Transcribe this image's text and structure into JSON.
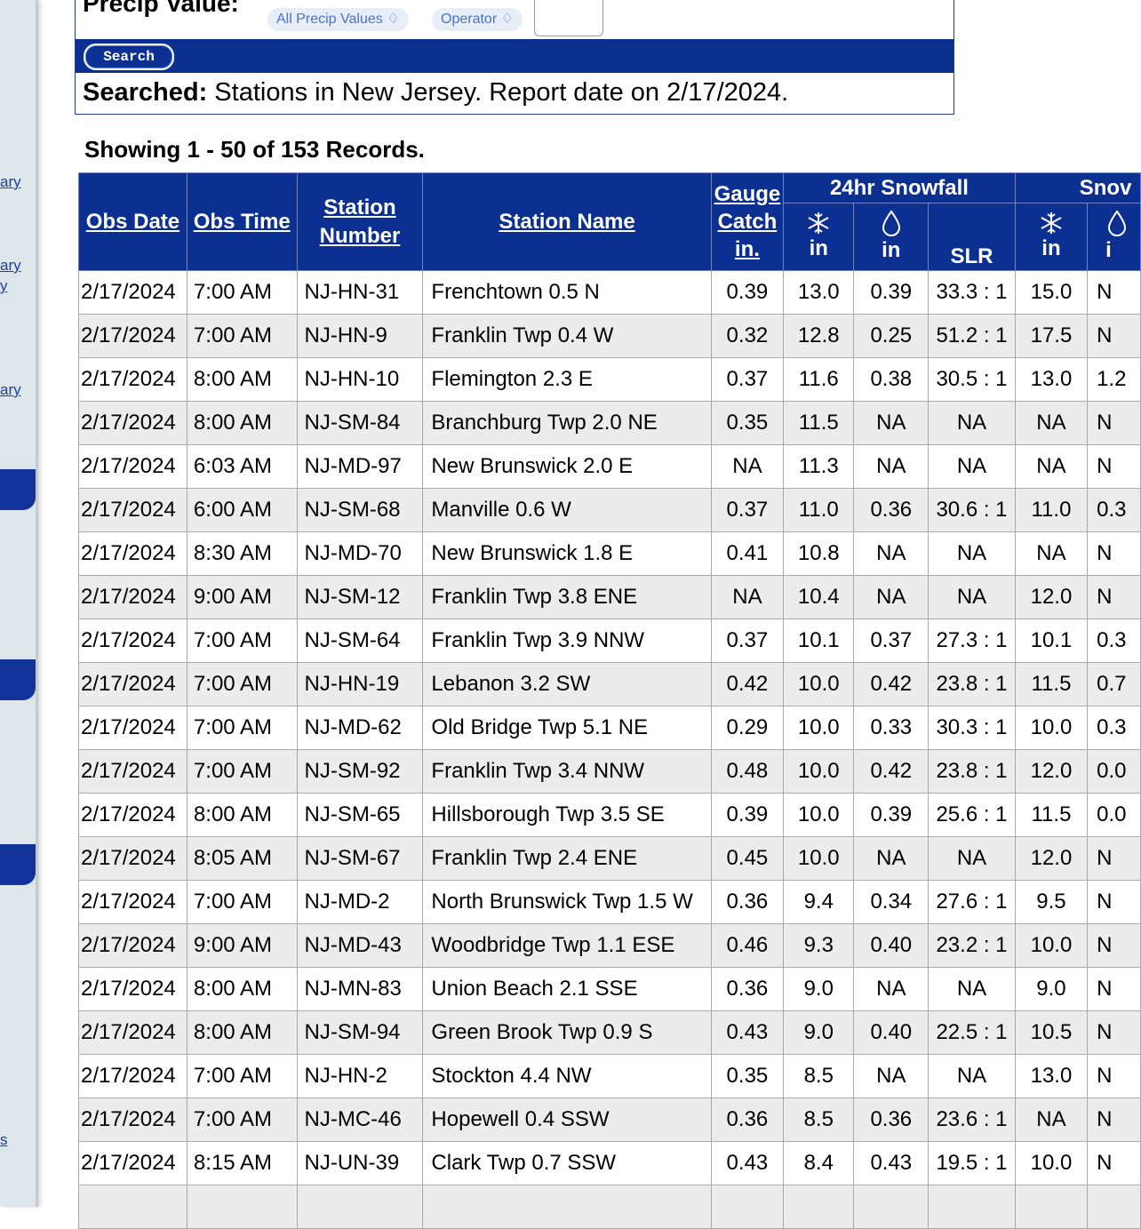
{
  "sidebar": {
    "links": [
      "ary",
      "ary",
      "y",
      "ary",
      "s"
    ]
  },
  "search_form": {
    "precip_label": "Precip Value:",
    "precip_select": "All Precip Values ♢",
    "operator_select": "Operator ♢",
    "precip_input_value": "",
    "search_button": "Search",
    "searched_label": "Searched:",
    "searched_text": " Stations in New Jersey. Report date on 2/17/2024."
  },
  "results": {
    "showing": "Showing 1 - 50 of 153 Records."
  },
  "table": {
    "headers": {
      "obs_date": "Obs Date",
      "obs_time": "Obs Time",
      "station_number": "Station Number",
      "station_name": "Station Name",
      "gauge_catch_1": "Gauge",
      "gauge_catch_2": "Catch",
      "gauge_catch_3": "in.",
      "snowfall_group": "24hr Snowfall",
      "snow_group": "Snov",
      "unit_in": "in",
      "slr": "SLR",
      "unit_in_clipped": "i"
    },
    "rows": [
      [
        "2/17/2024",
        "7:00 AM",
        "NJ-HN-31",
        "Frenchtown 0.5 N",
        "0.39",
        "13.0",
        "0.39",
        "33.3 : 1",
        "15.0",
        "N"
      ],
      [
        "2/17/2024",
        "7:00 AM",
        "NJ-HN-9",
        "Franklin Twp 0.4 W",
        "0.32",
        "12.8",
        "0.25",
        "51.2 : 1",
        "17.5",
        "N"
      ],
      [
        "2/17/2024",
        "8:00 AM",
        "NJ-HN-10",
        "Flemington 2.3 E",
        "0.37",
        "11.6",
        "0.38",
        "30.5 : 1",
        "13.0",
        "1.2"
      ],
      [
        "2/17/2024",
        "8:00 AM",
        "NJ-SM-84",
        "Branchburg Twp 2.0 NE",
        "0.35",
        "11.5",
        "NA",
        "NA",
        "NA",
        "N"
      ],
      [
        "2/17/2024",
        "6:03 AM",
        "NJ-MD-97",
        "New Brunswick 2.0 E",
        "NA",
        "11.3",
        "NA",
        "NA",
        "NA",
        "N"
      ],
      [
        "2/17/2024",
        "6:00 AM",
        "NJ-SM-68",
        "Manville 0.6 W",
        "0.37",
        "11.0",
        "0.36",
        "30.6 : 1",
        "11.0",
        "0.3"
      ],
      [
        "2/17/2024",
        "8:30 AM",
        "NJ-MD-70",
        "New Brunswick 1.8 E",
        "0.41",
        "10.8",
        "NA",
        "NA",
        "NA",
        "N"
      ],
      [
        "2/17/2024",
        "9:00 AM",
        "NJ-SM-12",
        "Franklin Twp 3.8 ENE",
        "NA",
        "10.4",
        "NA",
        "NA",
        "12.0",
        "N"
      ],
      [
        "2/17/2024",
        "7:00 AM",
        "NJ-SM-64",
        "Franklin Twp 3.9 NNW",
        "0.37",
        "10.1",
        "0.37",
        "27.3 : 1",
        "10.1",
        "0.3"
      ],
      [
        "2/17/2024",
        "7:00 AM",
        "NJ-HN-19",
        "Lebanon 3.2 SW",
        "0.42",
        "10.0",
        "0.42",
        "23.8 : 1",
        "11.5",
        "0.7"
      ],
      [
        "2/17/2024",
        "7:00 AM",
        "NJ-MD-62",
        "Old Bridge Twp 5.1 NE",
        "0.29",
        "10.0",
        "0.33",
        "30.3 : 1",
        "10.0",
        "0.3"
      ],
      [
        "2/17/2024",
        "7:00 AM",
        "NJ-SM-92",
        "Franklin Twp 3.4 NNW",
        "0.48",
        "10.0",
        "0.42",
        "23.8 : 1",
        "12.0",
        "0.0"
      ],
      [
        "2/17/2024",
        "8:00 AM",
        "NJ-SM-65",
        "Hillsborough Twp 3.5 SE",
        "0.39",
        "10.0",
        "0.39",
        "25.6 : 1",
        "11.5",
        "0.0"
      ],
      [
        "2/17/2024",
        "8:05 AM",
        "NJ-SM-67",
        "Franklin Twp 2.4 ENE",
        "0.45",
        "10.0",
        "NA",
        "NA",
        "12.0",
        "N"
      ],
      [
        "2/17/2024",
        "7:00 AM",
        "NJ-MD-2",
        "North Brunswick Twp 1.5 W",
        "0.36",
        "9.4",
        "0.34",
        "27.6 : 1",
        "9.5",
        "N"
      ],
      [
        "2/17/2024",
        "9:00 AM",
        "NJ-MD-43",
        "Woodbridge Twp 1.1 ESE",
        "0.46",
        "9.3",
        "0.40",
        "23.2 : 1",
        "10.0",
        "N"
      ],
      [
        "2/17/2024",
        "8:00 AM",
        "NJ-MN-83",
        "Union Beach 2.1 SSE",
        "0.36",
        "9.0",
        "NA",
        "NA",
        "9.0",
        "N"
      ],
      [
        "2/17/2024",
        "8:00 AM",
        "NJ-SM-94",
        "Green Brook Twp 0.9 S",
        "0.43",
        "9.0",
        "0.40",
        "22.5 : 1",
        "10.5",
        "N"
      ],
      [
        "2/17/2024",
        "7:00 AM",
        "NJ-HN-2",
        "Stockton 4.4 NW",
        "0.35",
        "8.5",
        "NA",
        "NA",
        "13.0",
        "N"
      ],
      [
        "2/17/2024",
        "7:00 AM",
        "NJ-MC-46",
        "Hopewell 0.4 SSW",
        "0.36",
        "8.5",
        "0.36",
        "23.6 : 1",
        "NA",
        "N"
      ],
      [
        "2/17/2024",
        "8:15 AM",
        "NJ-UN-39",
        "Clark Twp 0.7 SSW",
        "0.43",
        "8.4",
        "0.43",
        "19.5 : 1",
        "10.0",
        "N"
      ]
    ]
  },
  "colors": {
    "header_bg": "#0b3091",
    "row_alt": "#ececec",
    "link": "#1a3f9c"
  }
}
